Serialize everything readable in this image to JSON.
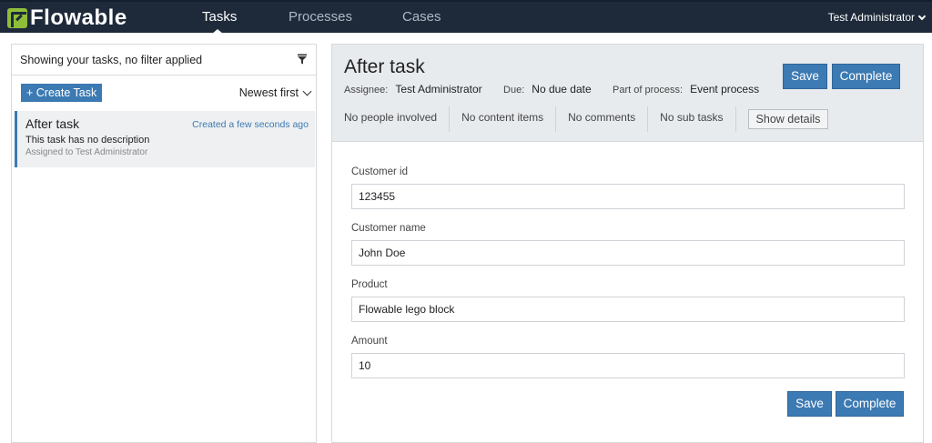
{
  "app": {
    "logo_text": "Flowable",
    "accent_color": "#3c7ab3",
    "nav_bg": "#1e2a3a"
  },
  "nav": {
    "tabs": [
      {
        "label": "Tasks",
        "active": true
      },
      {
        "label": "Processes",
        "active": false
      },
      {
        "label": "Cases",
        "active": false
      }
    ],
    "user": "Test Administrator",
    "user_icon": "chevron-down-icon"
  },
  "task_list": {
    "filter_text": "Showing your tasks, no filter applied",
    "filter_icon": "funnel-icon",
    "create_label": "+ Create Task",
    "sort_label": "Newest first",
    "items": [
      {
        "title": "After task",
        "created": "Created a few seconds ago",
        "description": "This task has no description",
        "assigned": "Assigned to Test Administrator"
      }
    ]
  },
  "task_detail": {
    "title": "After task",
    "assignee_label": "Assignee:",
    "assignee": "Test Administrator",
    "due_label": "Due:",
    "due": "No due date",
    "process_label": "Part of process:",
    "process": "Event process",
    "save_label": "Save",
    "complete_label": "Complete",
    "counts": [
      "No people involved",
      "No content items",
      "No comments",
      "No sub tasks"
    ],
    "show_details_label": "Show details"
  },
  "form": {
    "fields": [
      {
        "label": "Customer id",
        "value": "123455"
      },
      {
        "label": "Customer name",
        "value": "John Doe"
      },
      {
        "label": "Product",
        "value": "Flowable lego block"
      },
      {
        "label": "Amount",
        "value": "10"
      }
    ],
    "save_label": "Save",
    "complete_label": "Complete"
  }
}
